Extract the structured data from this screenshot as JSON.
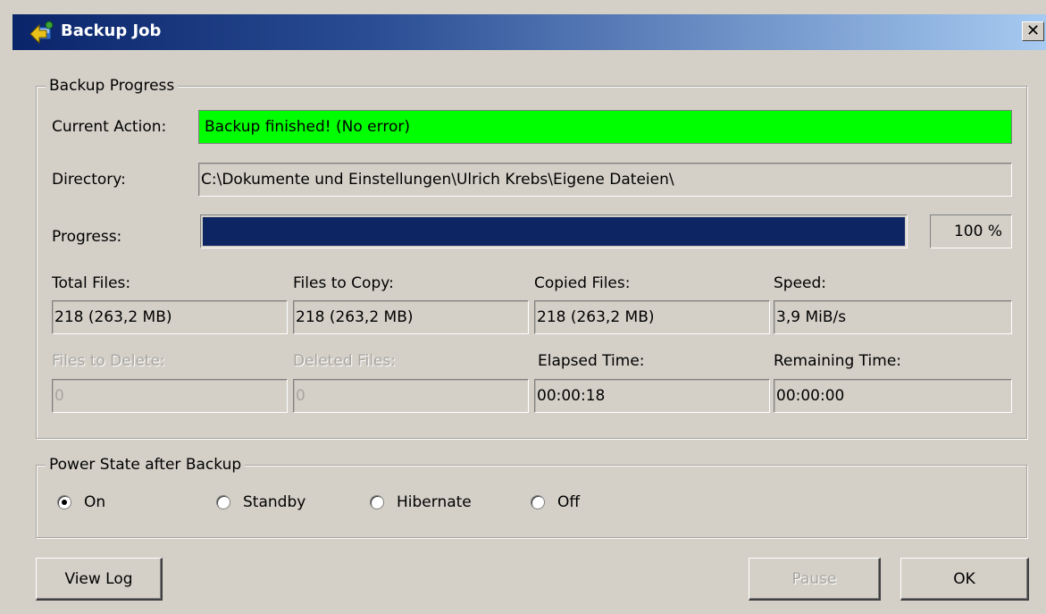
{
  "window": {
    "title": "Backup Job",
    "close_label": "✕"
  },
  "backup_progress": {
    "legend": "Backup Progress",
    "current_action_label": "Current Action:",
    "current_action_value": "Backup finished! (No error)",
    "current_action_color": "#00ff00",
    "directory_label": "Directory:",
    "directory_value": "C:\\Dokumente und Einstellungen\\Ulrich Krebs\\Eigene Dateien\\",
    "progress_label": "Progress:",
    "progress_percent": "100 %",
    "progress_fraction": 1.0,
    "progress_color": "#0e2563",
    "total_files_label": "Total Files:",
    "total_files_value": "218 (263,2 MB)",
    "files_to_copy_label": "Files to Copy:",
    "files_to_copy_value": "218 (263,2 MB)",
    "copied_files_label": "Copied Files:",
    "copied_files_value": "218 (263,2 MB)",
    "speed_label": "Speed:",
    "speed_value": "3,9 MiB/s",
    "files_to_delete_label": "Files to Delete:",
    "files_to_delete_value": "0",
    "deleted_files_label": "Deleted Files:",
    "deleted_files_value": "0",
    "elapsed_time_label": "Elapsed Time:",
    "elapsed_time_value": "00:00:18",
    "remaining_time_label": "Remaining Time:",
    "remaining_time_value": "00:00:00"
  },
  "power_state": {
    "legend": "Power State after Backup",
    "options": [
      {
        "label": "On",
        "checked": true
      },
      {
        "label": "Standby",
        "checked": false
      },
      {
        "label": "Hibernate",
        "checked": false
      },
      {
        "label": "Off",
        "checked": false
      }
    ]
  },
  "buttons": {
    "view_log": "View Log",
    "pause": "Pause",
    "ok": "OK"
  }
}
